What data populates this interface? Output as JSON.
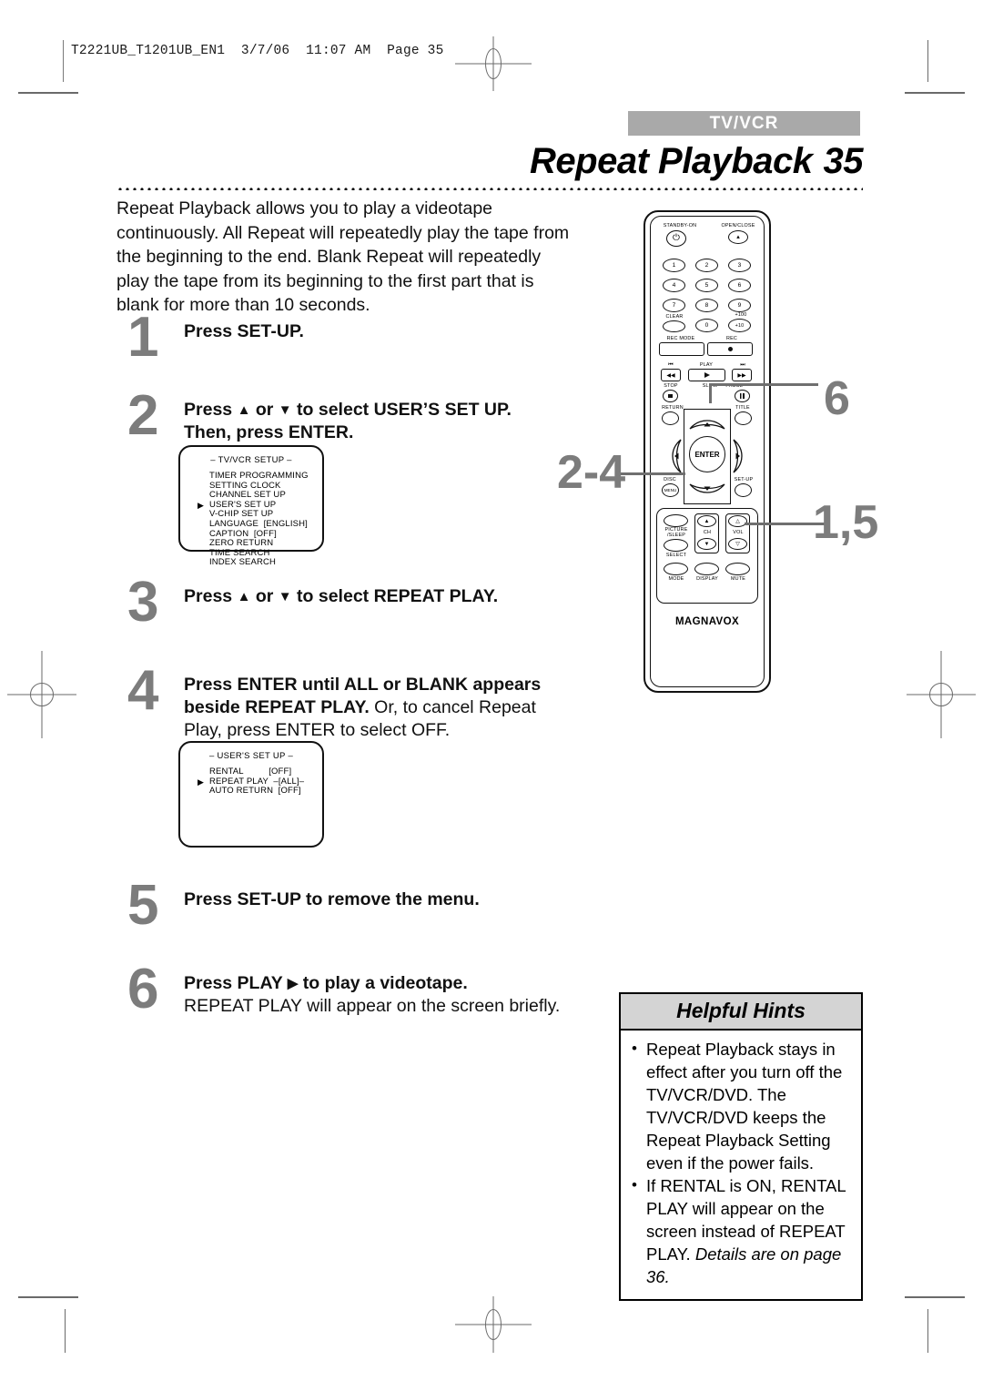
{
  "print_header": {
    "filestamp": "T2221UB_T1201UB_EN1  3/7/06  11:07 AM  Page 35"
  },
  "header": {
    "tab_label": "TV/VCR",
    "title": "Repeat Playback",
    "page_number": "35"
  },
  "intro": "Repeat Playback allows you to play a videotape continuously. All Repeat will repeatedly play the tape from the beginning to the end. Blank Repeat will repeatedly play the tape from its beginning to the first part that is blank for more than 10 seconds.",
  "steps": [
    {
      "num": "1",
      "text_html": "<b>Press SET-UP.</b>"
    },
    {
      "num": "2",
      "text_html": "<b>Press <span class=\"arrow-g\">▲</span> or <span class=\"arrow-g\">▼</span> to select USER’S SET UP.<br>Then, press ENTER.</b>"
    },
    {
      "num": "3",
      "text_html": "<b>Press <span class=\"arrow-g\">▲</span> or <span class=\"arrow-g\">▼</span> to select REPEAT PLAY.</b>"
    },
    {
      "num": "4",
      "text_html": "<b>Press ENTER until ALL or BLANK appears beside REPEAT PLAY.</b> Or, to cancel Repeat Play, press ENTER to select OFF."
    },
    {
      "num": "5",
      "text_html": "<b>Press SET-UP to remove the menu.</b>"
    },
    {
      "num": "6",
      "text_html": "<b>Press PLAY <span class=\"arrow-g\">▶</span> to play a videotape.</b><br>REPEAT PLAY will appear on the screen briefly."
    }
  ],
  "osd_menus": [
    {
      "title": "– TV/VCR SETUP –",
      "items": [
        {
          "label": "TIMER PROGRAMMING",
          "value": "",
          "selected": false
        },
        {
          "label": "SETTING CLOCK",
          "value": "",
          "selected": false
        },
        {
          "label": "CHANNEL SET UP",
          "value": "",
          "selected": false
        },
        {
          "label": "USER'S SET UP",
          "value": "",
          "selected": true
        },
        {
          "label": "V-CHIP SET UP",
          "value": "",
          "selected": false
        },
        {
          "label": "LANGUAGE  [ENGLISH]",
          "value": "",
          "selected": false
        },
        {
          "label": "CAPTION  [OFF]",
          "value": "",
          "selected": false
        },
        {
          "label": "ZERO RETURN",
          "value": "",
          "selected": false
        },
        {
          "label": "TIME SEARCH",
          "value": "",
          "selected": false
        },
        {
          "label": "INDEX SEARCH",
          "value": "",
          "selected": false
        }
      ]
    },
    {
      "title": "– USER'S SET UP –",
      "items": [
        {
          "label": "RENTAL          [OFF]",
          "value": "",
          "selected": false
        },
        {
          "label": "REPEAT PLAY  –[ALL]–",
          "value": "",
          "selected": true
        },
        {
          "label": "AUTO RETURN  [OFF]",
          "value": "",
          "selected": false
        }
      ]
    }
  ],
  "remote": {
    "brand": "MAGNAVOX",
    "labels": {
      "standby": "STANDBY-ON",
      "open_close": "OPEN/CLOSE",
      "clear": "CLEAR",
      "plus100": "+100",
      "plus10": "+10",
      "rec_mode": "REC MODE",
      "rec": "REC",
      "skip_back": "⏮",
      "skip_fwd": "⏭",
      "play": "PLAY",
      "rew": "◀◀",
      "ff": "▶▶",
      "stop": "STOP",
      "slow_pause": "SLOW — PAUSE",
      "return": "RETURN",
      "title": "TITLE",
      "enter": "ENTER",
      "disc": "DISC",
      "disc_menu": "MENU",
      "setup": "SET-UP",
      "picture_sleep": "PICTURE\n/SLEEP",
      "select": "SELECT",
      "ch": "CH",
      "vol": "VOL",
      "mode": "MODE",
      "display": "DISPLAY",
      "mute": "MUTE"
    },
    "keypad": [
      "1",
      "2",
      "3",
      "4",
      "5",
      "6",
      "7",
      "8",
      "9",
      "0"
    ]
  },
  "callouts": [
    {
      "id": "six",
      "label": "6"
    },
    {
      "id": "two-four",
      "label": "2-4"
    },
    {
      "id": "one-five",
      "label": "1,5"
    }
  ],
  "hints": {
    "heading": "Helpful Hints",
    "items_html": [
      "Repeat Playback stays in effect after you turn off the TV/VCR/DVD. The TV/VCR/DVD keeps the Repeat Playback Setting even if the power fails.",
      "If RENTAL is ON, RENTAL PLAY will appear on the screen instead of REPEAT PLAY. <i>Details are on page 36.</i>"
    ]
  },
  "colors": {
    "tab_gray": "#a9a9a9",
    "step_number_gray": "#7c7c7c",
    "hints_header_gray": "#d4d4d4"
  }
}
